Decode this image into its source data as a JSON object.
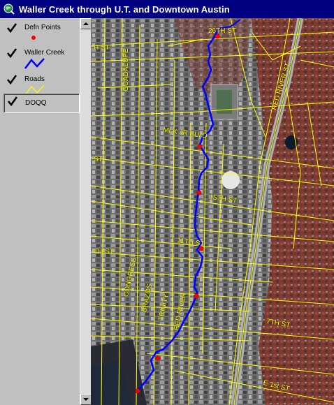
{
  "window": {
    "title": "Waller Creek through  U.T. and Downtown Austin"
  },
  "legend": {
    "items": [
      {
        "label": "Defn Points",
        "checked": true,
        "symbol": "red-dot-icon",
        "color": "#ff0000"
      },
      {
        "label": "Waller Creek",
        "checked": true,
        "symbol": "blue-line-icon",
        "color": "#0000ff"
      },
      {
        "label": "Roads",
        "checked": true,
        "symbol": "yellow-line-icon",
        "color": "#ffff00"
      },
      {
        "label": "DOQQ",
        "checked": true,
        "symbol": "",
        "color": ""
      }
    ]
  },
  "map": {
    "street_labels": [
      "26TH ST",
      "H ST",
      "GUADALUPE",
      "RED RIVER ST",
      "MLK JR BLVD",
      "ST",
      "15TH ST",
      "11TH ST",
      "TH ST",
      "CONGRESS",
      "BRAZOS",
      "TRINITY",
      "RED RIVER",
      "7TH ST",
      "E 1st ST"
    ],
    "colors": {
      "creek": "#0000ff",
      "roads": "#ffff00",
      "points": "#ff0000",
      "title_bar": "#000080"
    }
  }
}
